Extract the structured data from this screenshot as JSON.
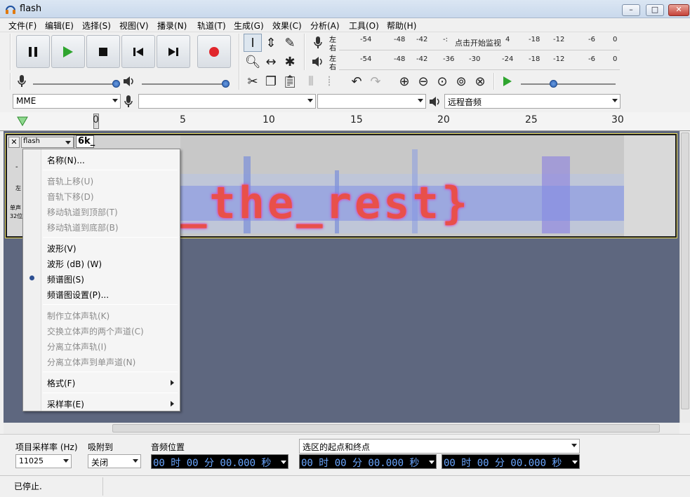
{
  "window": {
    "title": "flash",
    "minimize": "–",
    "maximize": "□",
    "close": "✕"
  },
  "menu": [
    "文件(F)",
    "编辑(E)",
    "选择(S)",
    "视图(V)",
    "播录(N)",
    "轨道(T)",
    "生成(G)",
    "效果(C)",
    "分析(A)",
    "工具(O)",
    "帮助(H)"
  ],
  "meters": {
    "record_lr_top": "左",
    "record_lr_bottom": "右",
    "play_lr_top": "左",
    "play_lr_bottom": "右",
    "record_ticks": [
      "-54",
      "-48",
      "-42",
      "-:",
      "4",
      "-18",
      "-12",
      "-6",
      "0"
    ],
    "monitor_prompt": "点击开始监视",
    "play_ticks": [
      "-54",
      "-48",
      "-42",
      "-36",
      "-30",
      "-24",
      "-18",
      "-12",
      "-6",
      "0"
    ]
  },
  "devices": {
    "host": "MME",
    "recording_device": "",
    "channels": "",
    "playback_device": "远程音频"
  },
  "ruler": {
    "ticks": [
      "0",
      "5",
      "10",
      "15",
      "20",
      "25",
      "30"
    ]
  },
  "track": {
    "name": "flash",
    "close_glyph": "✕",
    "rate_label": "6k_",
    "ctrl_dash": "-",
    "ctrl_left": "左",
    "ctrl_info_1": "单声",
    "ctrl_info_2": "32位"
  },
  "spectrogram_text": "_the_rest}",
  "context_menu": {
    "name": "名称(N)...",
    "move_up": "音轨上移(U)",
    "move_down": "音轨下移(D)",
    "move_top": "移动轨道到顶部(T)",
    "move_bottom": "移动轨道到底部(B)",
    "waveform": "波形(V)",
    "waveform_db": "波形 (dB) (W)",
    "spectrogram": "频谱图(S)",
    "spectrogram_settings": "频谱图设置(P)...",
    "make_stereo": "制作立体声轨(K)",
    "swap_channels": "交换立体声的两个声道(C)",
    "split_stereo": "分离立体声轨(I)",
    "split_mono": "分离立体声到单声道(N)",
    "format": "格式(F)",
    "rate": "采样率(E)"
  },
  "bottom": {
    "project_rate_label": "项目采样率 (Hz)",
    "project_rate_value": "11025",
    "snap_label": "吸附到",
    "snap_value": "关闭",
    "audio_position_label": "音频位置",
    "audio_position_value": "00 时 00 分 00.000 秒",
    "selection_mode": "选区的起点和终点",
    "selection_start": "00 时 00 分 00.000 秒",
    "selection_end": "00 时 00 分 00.000 秒"
  },
  "status": {
    "text": "已停止."
  },
  "colors": {
    "record": "#e0262c",
    "play": "#2fa52f",
    "spectro_text": "#e8504a",
    "spectro_noise": "#6f8fe8"
  }
}
